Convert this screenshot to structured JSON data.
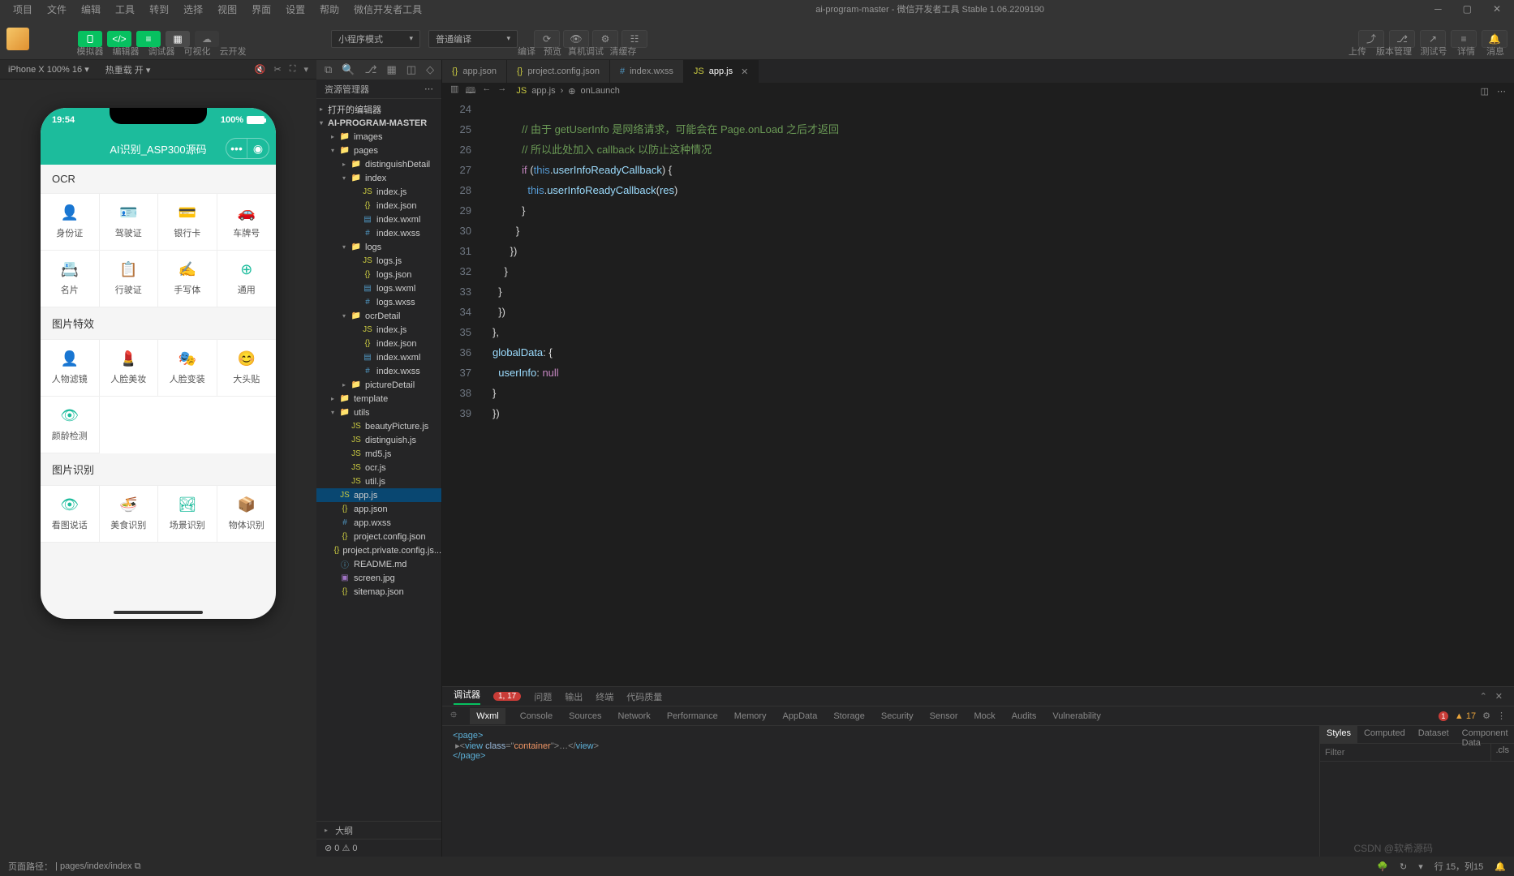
{
  "title": {
    "project": "ai-program-master",
    "app": "微信开发者工具 Stable 1.06.2209190"
  },
  "menu": [
    "项目",
    "文件",
    "编辑",
    "工具",
    "转到",
    "选择",
    "视图",
    "界面",
    "设置",
    "帮助",
    "微信开发者工具"
  ],
  "toolbar": {
    "labels": [
      "模拟器",
      "编辑器",
      "调试器",
      "可视化",
      "云开发"
    ],
    "mode": "小程序模式",
    "compile": "普通编译",
    "center_labels": [
      "编译",
      "预览",
      "真机调试",
      "清缓存"
    ],
    "right_labels": [
      "上传",
      "版本管理",
      "测试号",
      "详情",
      "消息"
    ]
  },
  "simbar": {
    "device": "iPhone X 100% 16",
    "reload": "热重载 开"
  },
  "phone": {
    "time": "19:54",
    "battery": "100%",
    "title": "AI识别_ASP300源码",
    "sections": {
      "ocr": {
        "title": "OCR",
        "cells": [
          "身份证",
          "驾驶证",
          "银行卡",
          "车牌号",
          "名片",
          "行驶证",
          "手写体",
          "通用"
        ]
      },
      "effect": {
        "title": "图片特效",
        "cells": [
          "人物滤镜",
          "人脸美妆",
          "人脸变装",
          "大头贴",
          "颜龄检测"
        ]
      },
      "recognize": {
        "title": "图片识别",
        "cells": [
          "看图说话",
          "美食识别",
          "场景识别",
          "物体识别"
        ]
      }
    }
  },
  "explorer": {
    "header": "资源管理器",
    "open_editors": "打开的编辑器",
    "root": "AI-PROGRAM-MASTER",
    "outline": "大纲",
    "status": "⊘ 0 ⚠ 0",
    "tree": [
      {
        "t": "folder",
        "n": "images",
        "d": 1,
        "open": false
      },
      {
        "t": "folder",
        "n": "pages",
        "d": 1,
        "open": true
      },
      {
        "t": "folder",
        "n": "distinguishDetail",
        "d": 2,
        "open": false
      },
      {
        "t": "folder",
        "n": "index",
        "d": 2,
        "open": true
      },
      {
        "t": "js",
        "n": "index.js",
        "d": 3
      },
      {
        "t": "json",
        "n": "index.json",
        "d": 3
      },
      {
        "t": "wxml",
        "n": "index.wxml",
        "d": 3
      },
      {
        "t": "wxss",
        "n": "index.wxss",
        "d": 3
      },
      {
        "t": "folder",
        "n": "logs",
        "d": 2,
        "open": true
      },
      {
        "t": "js",
        "n": "logs.js",
        "d": 3
      },
      {
        "t": "json",
        "n": "logs.json",
        "d": 3
      },
      {
        "t": "wxml",
        "n": "logs.wxml",
        "d": 3
      },
      {
        "t": "wxss",
        "n": "logs.wxss",
        "d": 3
      },
      {
        "t": "folder",
        "n": "ocrDetail",
        "d": 2,
        "open": true
      },
      {
        "t": "js",
        "n": "index.js",
        "d": 3
      },
      {
        "t": "json",
        "n": "index.json",
        "d": 3
      },
      {
        "t": "wxml",
        "n": "index.wxml",
        "d": 3
      },
      {
        "t": "wxss",
        "n": "index.wxss",
        "d": 3
      },
      {
        "t": "folder",
        "n": "pictureDetail",
        "d": 2,
        "open": false
      },
      {
        "t": "folder",
        "n": "template",
        "d": 1,
        "open": false
      },
      {
        "t": "folder",
        "n": "utils",
        "d": 1,
        "open": true
      },
      {
        "t": "js",
        "n": "beautyPicture.js",
        "d": 2
      },
      {
        "t": "js",
        "n": "distinguish.js",
        "d": 2
      },
      {
        "t": "js",
        "n": "md5.js",
        "d": 2
      },
      {
        "t": "js",
        "n": "ocr.js",
        "d": 2
      },
      {
        "t": "js",
        "n": "util.js",
        "d": 2
      },
      {
        "t": "js",
        "n": "app.js",
        "d": 1,
        "active": true
      },
      {
        "t": "json",
        "n": "app.json",
        "d": 1
      },
      {
        "t": "wxss",
        "n": "app.wxss",
        "d": 1
      },
      {
        "t": "json",
        "n": "project.config.json",
        "d": 1
      },
      {
        "t": "json",
        "n": "project.private.config.js...",
        "d": 1
      },
      {
        "t": "md",
        "n": "README.md",
        "d": 1
      },
      {
        "t": "jpg",
        "n": "screen.jpg",
        "d": 1
      },
      {
        "t": "json",
        "n": "sitemap.json",
        "d": 1
      }
    ]
  },
  "tabs": [
    {
      "icon": "json",
      "label": "app.json"
    },
    {
      "icon": "json",
      "label": "project.config.json"
    },
    {
      "icon": "wxss",
      "label": "index.wxss"
    },
    {
      "icon": "js",
      "label": "app.js",
      "active": true
    }
  ],
  "breadcrumb": {
    "file": "app.js",
    "fn": "onLaunch"
  },
  "code": {
    "start": 24,
    "lines": [
      "",
      "          // 由于 getUserInfo 是网络请求，可能会在 Page.onLoad 之后才返回",
      "          // 所以此处加入 callback 以防止这种情况",
      "          if (this.userInfoReadyCallback) {",
      "            this.userInfoReadyCallback(res)",
      "          }",
      "        }",
      "      })",
      "    }",
      "  }",
      "  })",
      "},",
      "globalData: {",
      "  userInfo: null",
      "}",
      "})"
    ]
  },
  "devtools": {
    "row1": [
      "调试器",
      "问题",
      "输出",
      "终端",
      "代码质量"
    ],
    "badge": "1, 17",
    "row2": [
      "Wxml",
      "Console",
      "Sources",
      "Network",
      "Performance",
      "Memory",
      "AppData",
      "Storage",
      "Security",
      "Sensor",
      "Mock",
      "Audits",
      "Vulnerability"
    ],
    "errors": "1",
    "warnings": "17",
    "dom_page_open": "<page>",
    "dom_view": "view",
    "dom_class_attr": "class",
    "dom_class_val": "container",
    "dom_page_close": "</page>",
    "style_tabs": [
      "Styles",
      "Computed",
      "Dataset",
      "Component Data"
    ],
    "filter_ph": "Filter",
    "cls": ".cls"
  },
  "statusbar": {
    "path_label": "页面路径：",
    "path": "pages/index/index",
    "pos": "行 15，列15",
    "watermark": "CSDN @软希源码"
  }
}
